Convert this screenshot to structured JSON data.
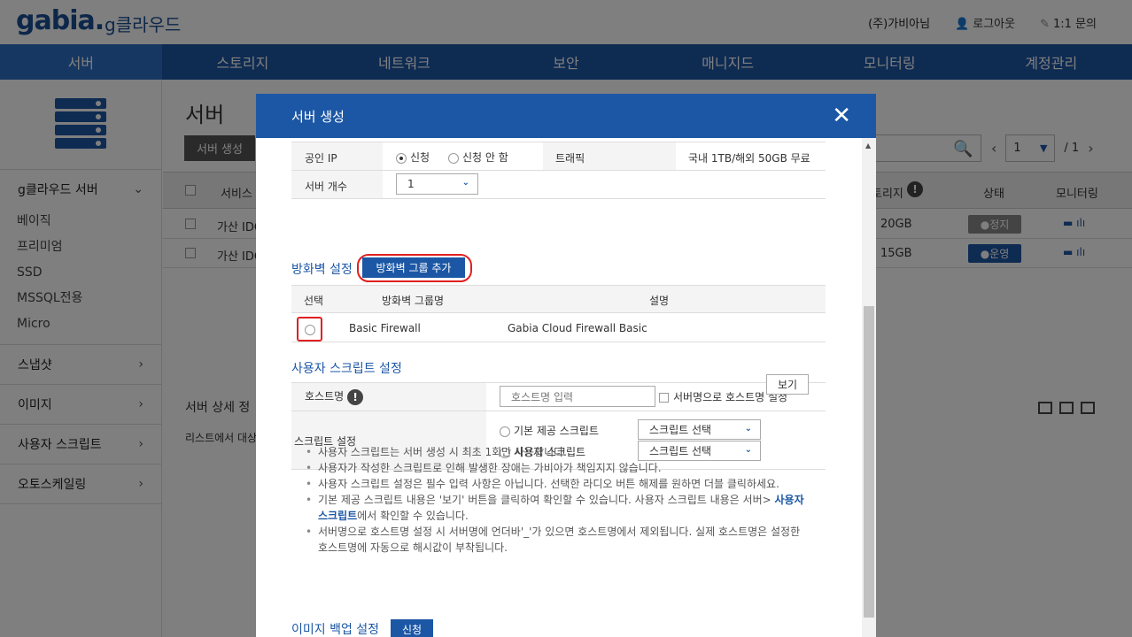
{
  "header": {
    "logo": "gabia.",
    "logo_sub": "g클라우드",
    "user": "(주)가비아님",
    "logout": "로그아웃",
    "inquiry": "1:1 문의"
  },
  "nav": [
    "서버",
    "스토리지",
    "네트워크",
    "보안",
    "매니지드",
    "모니터링",
    "계정관리"
  ],
  "sidebar": {
    "group_title": "g클라우드 서버",
    "sub_items": [
      "베이직",
      "프리미엄",
      "SSD",
      "MSSQL전용",
      "Micro"
    ],
    "sections": [
      "스냅샷",
      "이미지",
      "사용자 스크립트",
      "오토스케일링"
    ]
  },
  "page": {
    "title": "서버",
    "create_button": "서버 생성",
    "pager_value": "1",
    "pager_total": "/ 1",
    "col_service": "서비스",
    "col_storage": "토리지",
    "col_status": "상태",
    "col_monitoring": "모니터링",
    "rows": [
      {
        "service": "가산 IDC",
        "storage": "20GB",
        "status": "정지"
      },
      {
        "service": "가산 IDC",
        "storage": "15GB",
        "status": "운영"
      }
    ],
    "detail_title": "서버 상세 정",
    "detail_msg": "리스트에서 대상"
  },
  "modal": {
    "title": "서버 생성",
    "public_ip_label": "공인 IP",
    "ip_apply": "신청",
    "ip_no_apply": "신청 안 함",
    "traffic_label": "트래픽",
    "traffic_value": "국내 1TB/해외 50GB 무료",
    "server_count_label": "서버 개수",
    "server_count_value": "1",
    "firewall_title": "방화벽 설정",
    "firewall_add_button": "방화벽 그룹 추가",
    "fw_col_select": "선택",
    "fw_col_name": "방화벽 그룹명",
    "fw_col_desc": "설명",
    "fw_row_name": "Basic Firewall",
    "fw_row_desc": "Gabia Cloud Firewall Basic",
    "script_title": "사용자 스크립트 설정",
    "hostname_label": "호스트명",
    "hostname_placeholder": "호스트명 입력",
    "hostname_checkbox": "서버명으로 호스트명 설정",
    "script_label": "스크립트 설정",
    "script_default": "기본 제공 스크립트",
    "script_user": "사용자 스크립트",
    "script_select": "스크립트 선택",
    "view_button": "보기",
    "notes": [
      "사용자 스크립트는 서버 생성 시 최초 1회만 사용합니다.",
      "사용자가 작성한 스크립트로 인해 발생한 장애는 가비아가 책임지지 않습니다.",
      "사용자 스크립트 설정은 필수 입력 사항은 아닙니다. 선택한 라디오 버튼 해제를 원하면 더블 클릭하세요."
    ],
    "note4_a": "기본 제공 스크립트 내용은 '보기' 버튼을 클릭하여 확인할 수 있습니다. 사용자 스크립트 내용은 서버>",
    "note4_link": "사용자 스크립트",
    "note4_b": "에서 확인할 수 있습니다.",
    "note5": "서버명으로 호스트명 설정 시 서버명에 언더바'_'가 있으면 호스트명에서 제외됩니다. 실제 호스트명은 설정한 호스트명에 자동으로 해시값이 부착됩니다.",
    "backup_title": "이미지 백업 설정",
    "backup_apply": "신청"
  }
}
